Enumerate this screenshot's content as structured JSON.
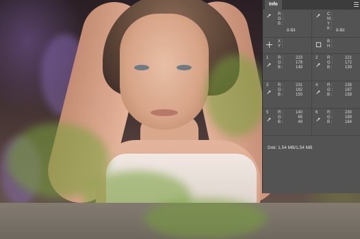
{
  "panel": {
    "tab_label": "Info",
    "menu_icon": "panel-menu-icon",
    "rgb_readout": {
      "labels": [
        "R :",
        "G :",
        "B :"
      ],
      "bit": "8-Bit"
    },
    "cmyk_readout": {
      "labels": [
        "C :",
        "M :",
        "Y :",
        "K :"
      ],
      "bit": "8-Bit"
    },
    "xy_readout": {
      "labels": [
        "X :",
        "Y :"
      ]
    },
    "wh_readout": {
      "labels": [
        "B :",
        "H :"
      ]
    },
    "samplers": [
      {
        "num": "1",
        "labels": [
          "R :",
          "G :",
          "B :"
        ],
        "values": [
          "223",
          "178",
          "148"
        ]
      },
      {
        "num": "2",
        "labels": [
          "R :",
          "G :",
          "B :"
        ],
        "values": [
          "221",
          "172",
          "139"
        ]
      },
      {
        "num": "3",
        "labels": [
          "R :",
          "G :",
          "B :"
        ],
        "values": [
          "231",
          "182",
          "150"
        ]
      },
      {
        "num": "4",
        "labels": [
          "R :",
          "G :",
          "B :"
        ],
        "values": [
          "235",
          "187",
          "158"
        ]
      },
      {
        "num": "5",
        "labels": [
          "R :",
          "G :",
          "B :"
        ],
        "values": [
          "140",
          "65",
          "49"
        ]
      },
      {
        "num": "6",
        "labels": [
          "R :",
          "G :",
          "B :"
        ],
        "values": [
          "230",
          "189",
          "164"
        ]
      }
    ],
    "doc_size": "Dok: 1,54 MB/1,54 MB"
  },
  "colors": {
    "panel_bg": "#535353",
    "header_bg": "#3c3c3c",
    "text": "#dcdcdc"
  }
}
